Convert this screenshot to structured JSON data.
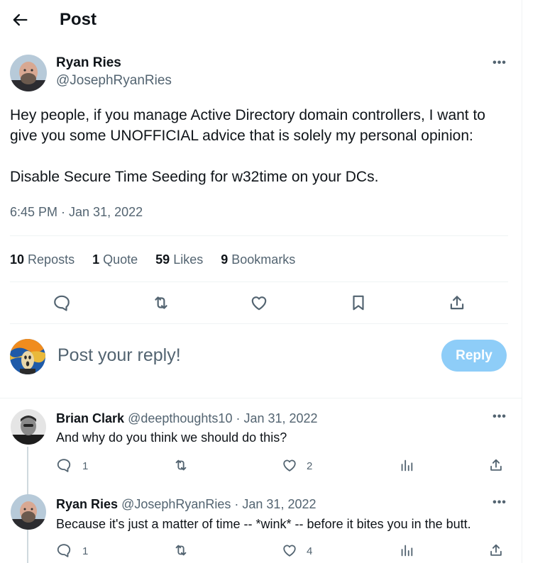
{
  "header": {
    "title": "Post",
    "back_icon": "arrow-left-icon"
  },
  "post": {
    "author_name": "Ryan Ries",
    "author_handle": "@JosephRyanRies",
    "text_line1": "Hey people, if you manage Active Directory domain controllers, I want to",
    "text_line2": "give you some UNOFFICIAL advice that is solely my personal opinion:",
    "text_line3": "Disable Secure Time Seeding for w32time on your DCs.",
    "timestamp": "6:45 PM · Jan 31, 2022",
    "more_label": "•••"
  },
  "stats": {
    "reposts_count": "10",
    "reposts_label": "Reposts",
    "quotes_count": "1",
    "quotes_label": "Quote",
    "likes_count": "59",
    "likes_label": "Likes",
    "bookmarks_count": "9",
    "bookmarks_label": "Bookmarks"
  },
  "actions": [
    "reply-icon",
    "repost-icon",
    "like-icon",
    "bookmark-icon",
    "share-icon"
  ],
  "reply_box": {
    "placeholder": "Post your reply!",
    "button_label": "Reply"
  },
  "replies": [
    {
      "name": "Brian Clark",
      "handle_date": "@deepthoughts10 · Jan 31, 2022",
      "text": "And why do you think we should do this?",
      "reply_count": "1",
      "like_count": "2",
      "more_label": "•••"
    },
    {
      "name": "Ryan Ries",
      "handle_date": "@JosephRyanRies · Jan 31, 2022",
      "text": "Because it's just a matter of time -- *wink* -- before it bites you in the butt.",
      "reply_count": "1",
      "like_count": "4",
      "more_label": "•••"
    }
  ],
  "colors": {
    "text": "#0f1419",
    "secondary": "#536471",
    "divider": "#eff3f4",
    "reply_button": "#8ecdf8"
  }
}
